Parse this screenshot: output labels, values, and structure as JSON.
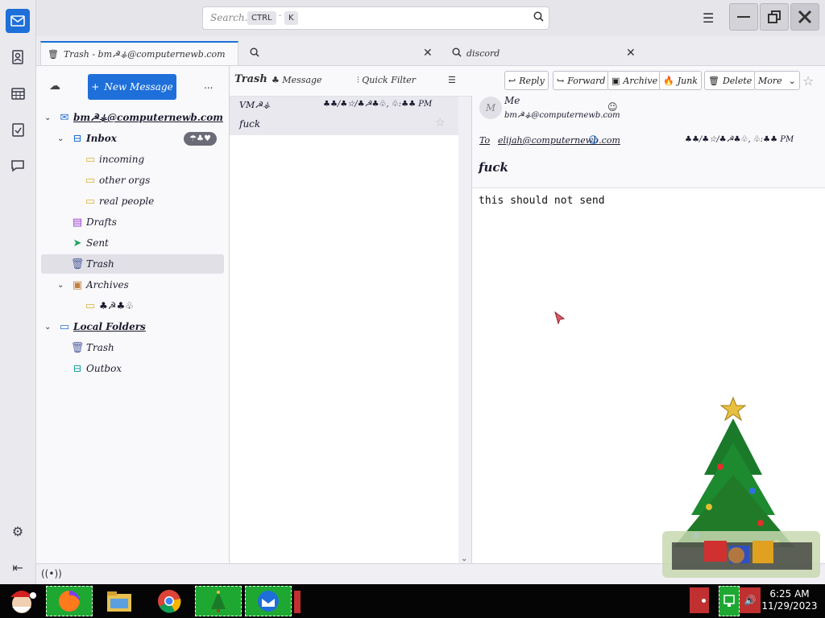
{
  "titlebar": {
    "search_placeholder": "Search...",
    "shortcut_ctrl": "CTRL",
    "shortcut_sep": "·",
    "shortcut_key": "K"
  },
  "tabs": [
    {
      "label": "Trash - bm☭⚶@computernewb.com"
    },
    {
      "label": ""
    },
    {
      "label": "discord"
    }
  ],
  "folder_pane": {
    "new_message": "New Message",
    "more": "...",
    "account": "bm☭⚶@computernewb.com",
    "folders": [
      {
        "label": "Inbox",
        "badge": "☂♣♥"
      },
      {
        "label": "incoming"
      },
      {
        "label": "other orgs"
      },
      {
        "label": "real people"
      },
      {
        "label": "Drafts"
      },
      {
        "label": "Sent"
      },
      {
        "label": "Trash"
      },
      {
        "label": "Archives"
      },
      {
        "label": "♣☭♣♧"
      }
    ],
    "local_folders": "Local Folders",
    "local": [
      {
        "label": "Trash"
      },
      {
        "label": "Outbox"
      }
    ]
  },
  "thread_pane": {
    "folder_name": "Trash",
    "message_label": "Message",
    "quick_filter": "Quick Filter",
    "rows": [
      {
        "sender": "VM☭⚶",
        "date": "♣♣/♣☆/♣☭♣♧, ♧:♣♣ PM",
        "subject": "fuck"
      }
    ]
  },
  "message_pane": {
    "buttons": [
      "Reply",
      "Forward",
      "Archive",
      "Junk",
      "Delete",
      "More"
    ],
    "from_name": "Me",
    "from_email": "bm☭⚶@computernewb.com",
    "avatar_letter": "M",
    "to_label": "To",
    "to_email": "elijah@computernewb.com",
    "date": "♣♣/♣☆/♣☭♣♧, ♧:♣♣ PM",
    "subject": "fuck",
    "body": "this should not send"
  },
  "taskbar": {
    "time": "6:25 AM",
    "date": "11/29/2023"
  },
  "colors": {
    "accent": "#1e6fd9",
    "taskbar": "#050505",
    "taskbar_app": "#1ea832"
  }
}
